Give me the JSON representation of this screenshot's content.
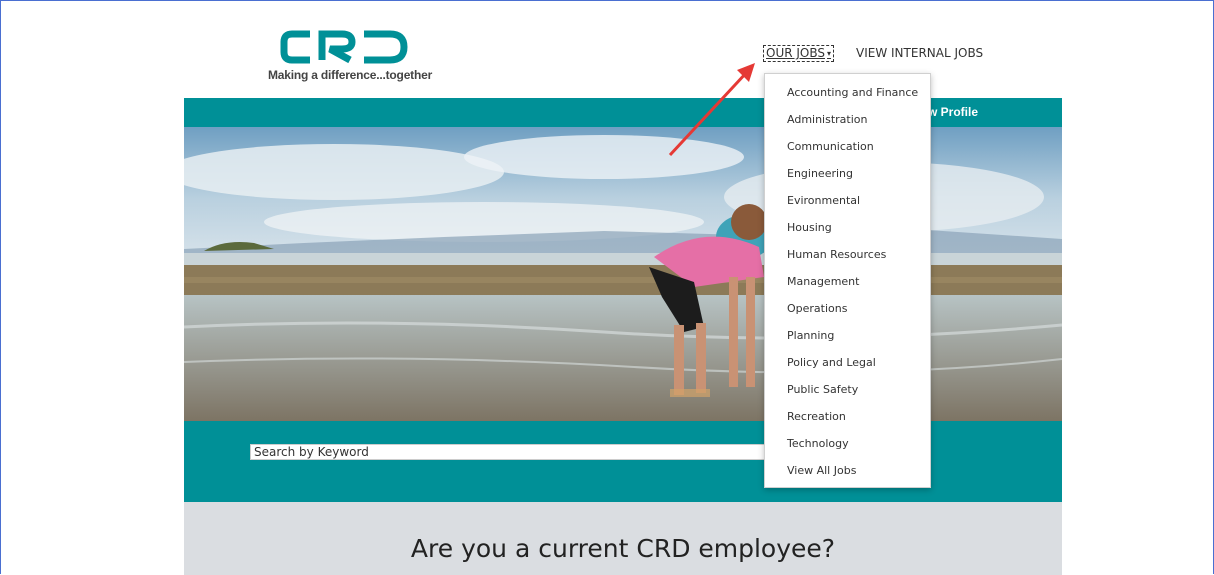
{
  "logo": {
    "name": "CRD",
    "tagline": "Making a difference...together",
    "color": "#009097"
  },
  "nav": {
    "our_jobs": "OUR JOBS",
    "internal_jobs": "VIEW INTERNAL JOBS",
    "profile": "View Profile"
  },
  "dropdown": {
    "items": [
      "Accounting and Finance",
      "Administration",
      "Communication",
      "Engineering",
      "Evironmental",
      "Housing",
      "Human Resources",
      "Management",
      "Operations",
      "Planning",
      "Policy and Legal",
      "Public Safety",
      "Recreation",
      "Technology",
      "View All Jobs"
    ]
  },
  "search": {
    "placeholder": "Search by Keyword"
  },
  "employee": {
    "question": "Are you a current CRD employee?"
  },
  "colors": {
    "teal": "#009097",
    "gray_band": "#dadde1",
    "annotation_arrow": "#e53935"
  }
}
